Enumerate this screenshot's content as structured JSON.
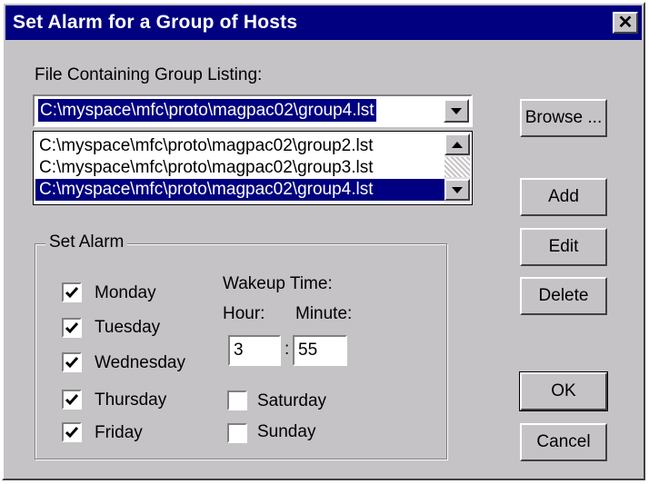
{
  "window": {
    "title": "Set Alarm for a Group of Hosts",
    "close_label": "✕"
  },
  "file": {
    "label": "File Containing Group Listing:",
    "selected": "C:\\myspace\\mfc\\proto\\magpac02\\group4.lst",
    "options": [
      "C:\\myspace\\mfc\\proto\\magpac02\\group2.lst",
      "C:\\myspace\\mfc\\proto\\magpac02\\group3.lst",
      "C:\\myspace\\mfc\\proto\\magpac02\\group4.lst"
    ]
  },
  "buttons": {
    "browse": "Browse ...",
    "add": "Add",
    "edit": "Edit",
    "delete": "Delete",
    "ok": "OK",
    "cancel": "Cancel"
  },
  "alarm": {
    "group_label": "Set Alarm",
    "wakeup_label": "Wakeup Time:",
    "hour_label": "Hour:",
    "minute_label": "Minute:",
    "hour_value": "3",
    "minute_value": "55",
    "separator": ":",
    "days": {
      "monday": "Monday",
      "tuesday": "Tuesday",
      "wednesday": "Wednesday",
      "thursday": "Thursday",
      "friday": "Friday",
      "saturday": "Saturday",
      "sunday": "Sunday"
    },
    "checked": {
      "monday": true,
      "tuesday": true,
      "wednesday": true,
      "thursday": true,
      "friday": true,
      "saturday": false,
      "sunday": false
    }
  }
}
